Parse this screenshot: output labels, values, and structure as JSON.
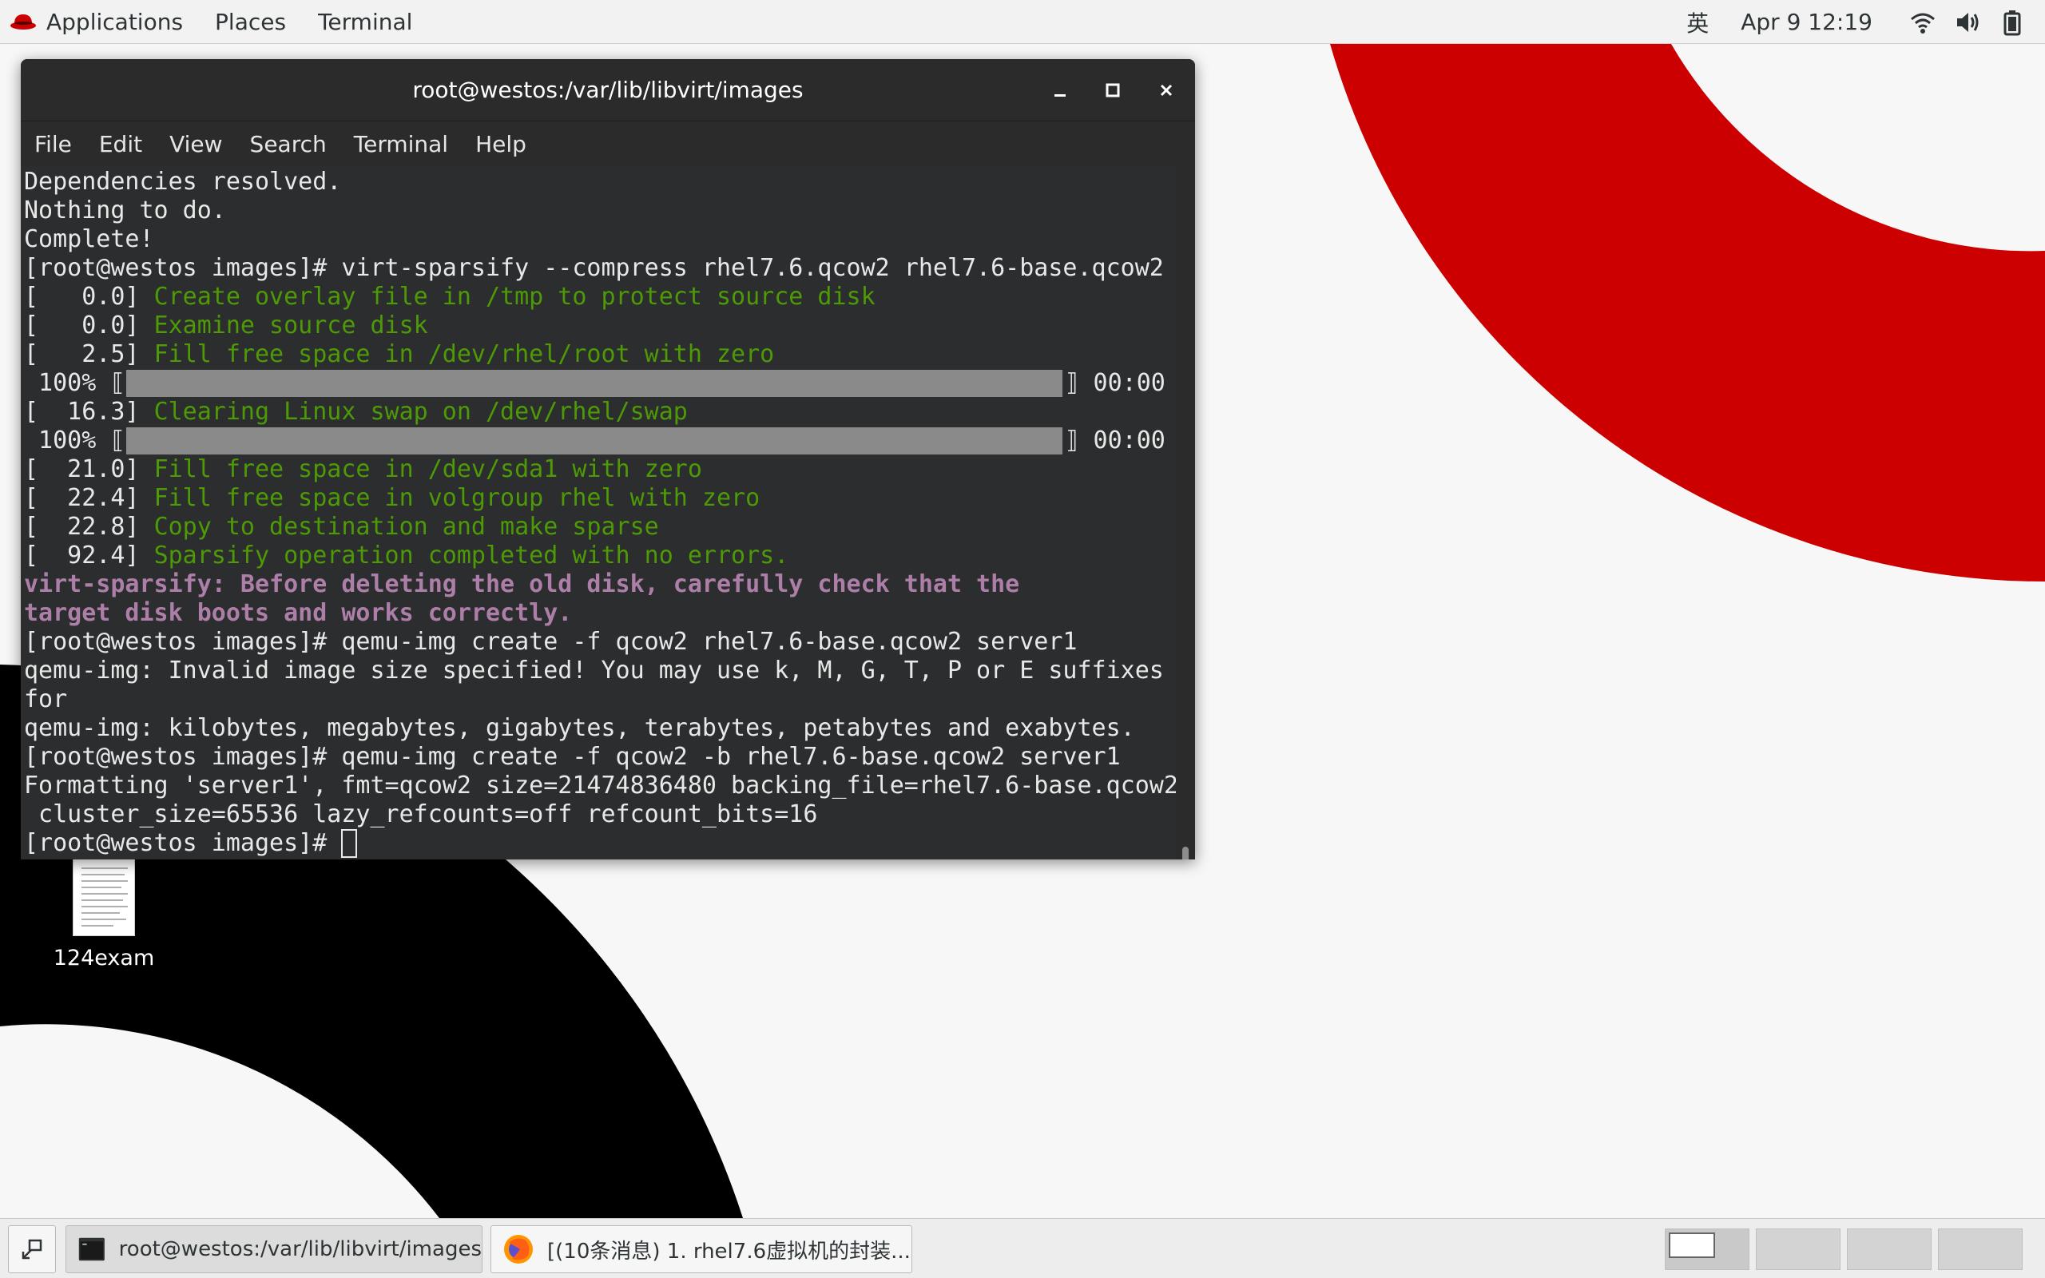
{
  "topbar": {
    "applications": "Applications",
    "places": "Places",
    "terminal": "Terminal",
    "input_method": "英",
    "date": "Apr 9",
    "time": "12:19"
  },
  "window": {
    "title": "root@westos:/var/lib/libvirt/images",
    "menu": [
      "File",
      "Edit",
      "View",
      "Search",
      "Terminal",
      "Help"
    ]
  },
  "terminal_lines": [
    "Dependencies resolved.",
    "Nothing to do.",
    "Complete!",
    "[root@westos images]# virt-sparsify --compress rhel7.6.qcow2 rhel7.6-base.qcow2",
    {
      "prefix": "[   0.0] ",
      "text": "Create overlay file in /tmp to protect source disk"
    },
    {
      "prefix": "[   0.0] ",
      "text": "Examine source disk"
    },
    {
      "prefix": "[   2.5] ",
      "text": "Fill free space in /dev/rhel/root with zero"
    },
    {
      "progress": " 100% ⟦",
      "end": "⟧ 00:00",
      "percent": 100
    },
    {
      "prefix": "[  16.3] ",
      "text": "Clearing Linux swap on /dev/rhel/swap"
    },
    {
      "progress": " 100% ⟦",
      "end": "⟧ 00:00",
      "percent": 100
    },
    {
      "prefix": "[  21.0] ",
      "text": "Fill free space in /dev/sda1 with zero"
    },
    {
      "prefix": "[  22.4] ",
      "text": "Fill free space in volgroup rhel with zero"
    },
    {
      "prefix": "[  22.8] ",
      "text": "Copy to destination and make sparse"
    },
    {
      "prefix": "[  92.4] ",
      "text": "Sparsify operation completed with no errors."
    },
    {
      "warn": "virt-sparsify: Before deleting the old disk, carefully check that the"
    },
    {
      "warn": "target disk boots and works correctly."
    },
    "[root@westos images]# qemu-img create -f qcow2 rhel7.6-base.qcow2 server1",
    "qemu-img: Invalid image size specified! You may use k, M, G, T, P or E suffixes",
    "for",
    "qemu-img: kilobytes, megabytes, gigabytes, terabytes, petabytes and exabytes.",
    "[root@westos images]# qemu-img create -f qcow2 -b rhel7.6-base.qcow2 server1",
    "Formatting 'server1', fmt=qcow2 size=21474836480 backing_file=rhel7.6-base.qcow2",
    " cluster_size=65536 lazy_refcounts=off refcount_bits=16"
  ],
  "prompt": "[root@westos images]# ",
  "desktop_icon": {
    "label": "124exam"
  },
  "taskbar": {
    "terminal_task": "root@westos:/var/lib/libvirt/images",
    "firefox_task": "[(10条消息) 1. rhel7.6虚拟机的封装..."
  },
  "colors": {
    "terminal_bg": "#2b2d2e",
    "green_text": "#4e9a06",
    "warning_text": "#ad7fa8",
    "redhat_red": "#cc0000"
  }
}
